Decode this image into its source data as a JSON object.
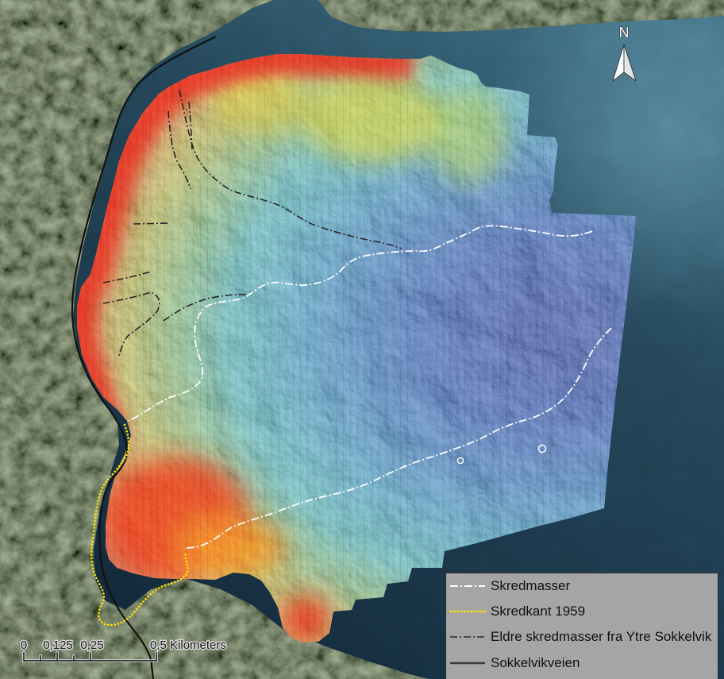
{
  "map": {
    "north_arrow": {
      "label": "N",
      "icon": "north-arrow-icon"
    },
    "scale_bar": {
      "labels": [
        "0",
        "0,125",
        "0,25",
        "0,5 Kilometers"
      ]
    },
    "legend": {
      "items": [
        {
          "label": "Skredmasser",
          "color": "#ffffff"
        },
        {
          "label": "Skredkant 1959",
          "color": "#ffe600"
        },
        {
          "label": "Eldre skredmasser fra Ytre Sokkelvik",
          "color": "#2a2a2a"
        },
        {
          "label": "Sokkelvikveien",
          "color": "#3c3c3c"
        }
      ]
    },
    "colors": {
      "bathymetry_shallow": "#e2231a",
      "bathymetry_mid": "#d2c838",
      "bathymetry_deep": "#0a2ea8",
      "water": "#1c3a4c",
      "land": "#2f3c2d",
      "legend_background": "#a5a5a5"
    }
  }
}
